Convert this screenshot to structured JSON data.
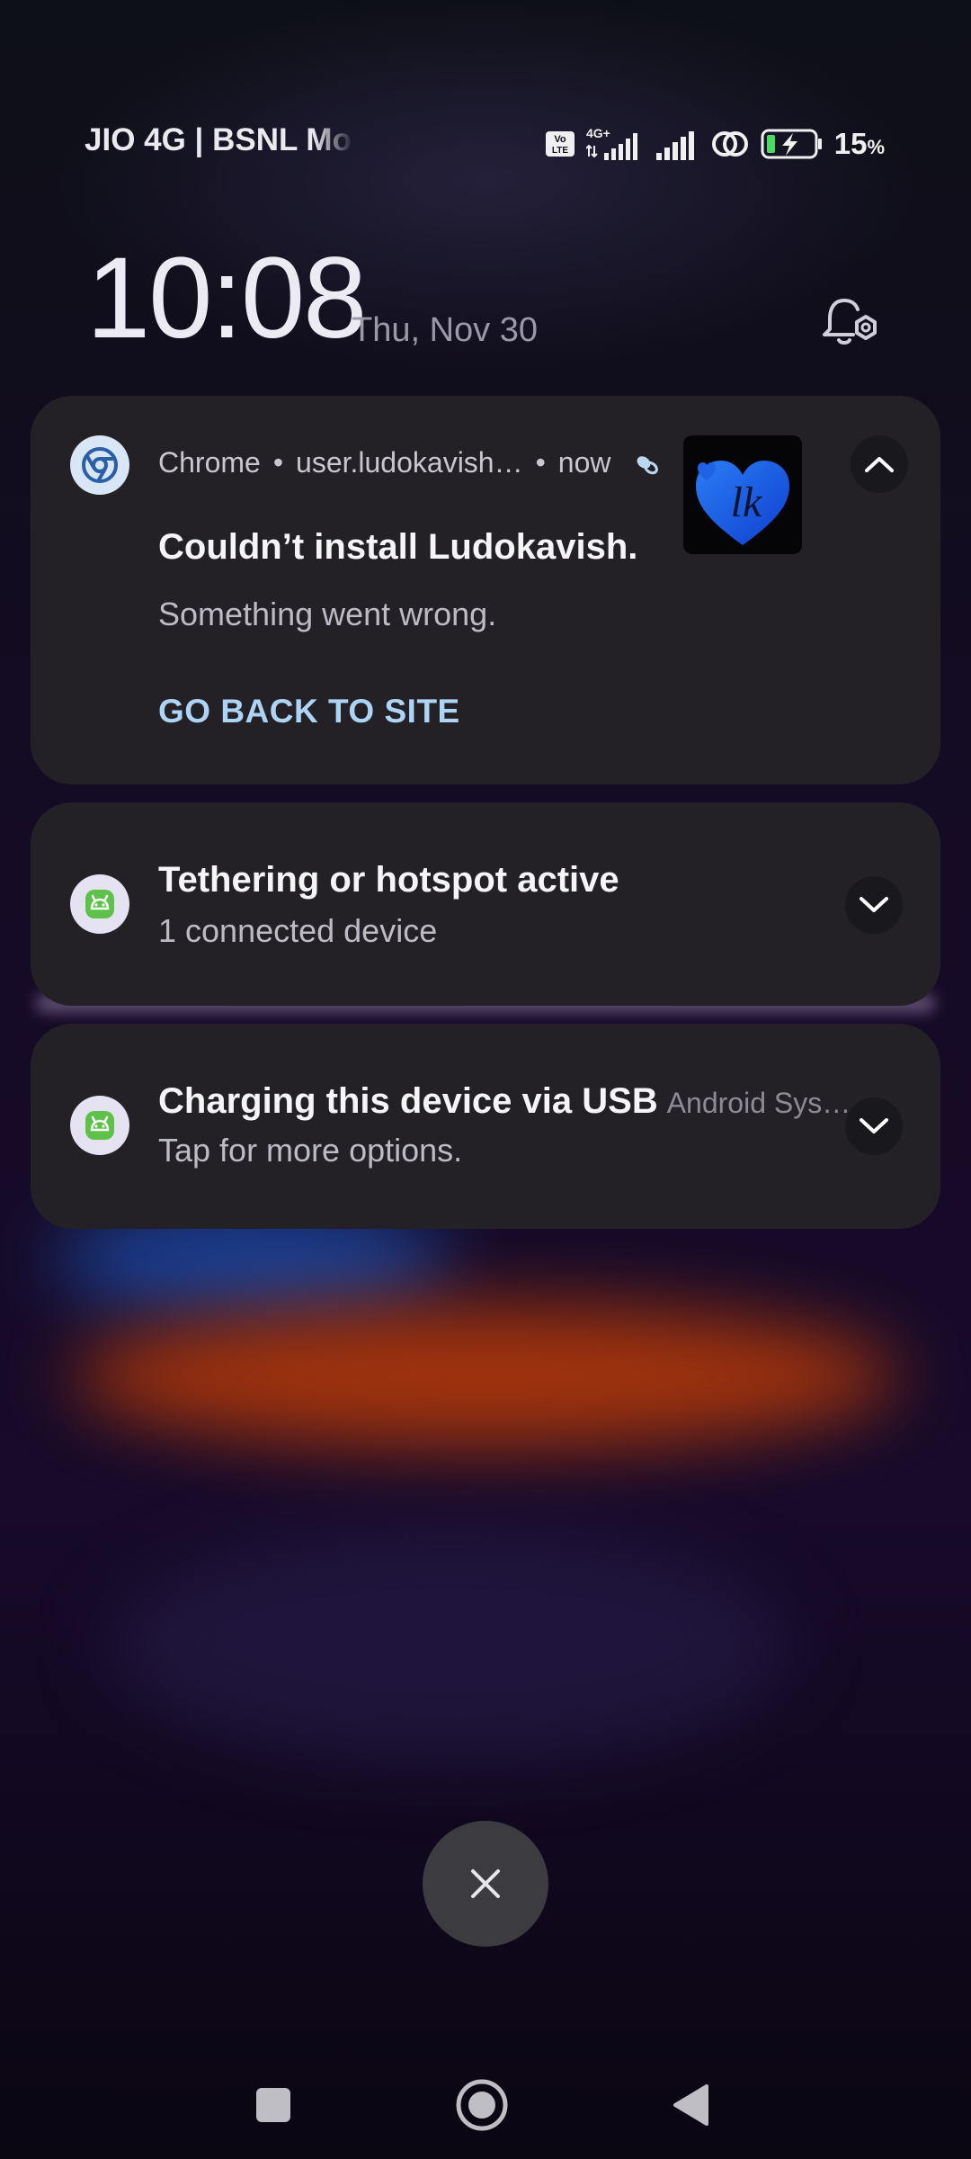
{
  "status_bar": {
    "carrier": "JIO 4G | BSNL Mobile",
    "volte_label": "Vo LTE",
    "network_label": "4G+",
    "battery_percent": "15",
    "battery_unit": "%",
    "icons": [
      "volte-icon",
      "signal-icon",
      "signal-icon",
      "hotspot-icon",
      "battery-charging-icon"
    ]
  },
  "lockscreen": {
    "time": "10:08",
    "date": "Thu, Nov 30"
  },
  "notifications": [
    {
      "app": "Chrome",
      "source": "user.ludokavish…",
      "time": "now",
      "title": "Couldn’t install Ludokavish.",
      "text": "Something went wrong.",
      "action": "GO BACK TO SITE",
      "thumbnail_text": "lk",
      "icon": "chrome-icon",
      "expanded": true
    },
    {
      "title": "Tethering or hotspot active",
      "text": "1 connected device",
      "icon": "android-icon",
      "expanded": false
    },
    {
      "title": "Charging this device via USB",
      "app_label": "Android Sys…",
      "text": "Tap for more options.",
      "icon": "android-icon",
      "expanded": false
    }
  ],
  "colors": {
    "card_bg": "#232126",
    "action_blue": "#aed4f5",
    "android_green": "#5ec24a"
  }
}
